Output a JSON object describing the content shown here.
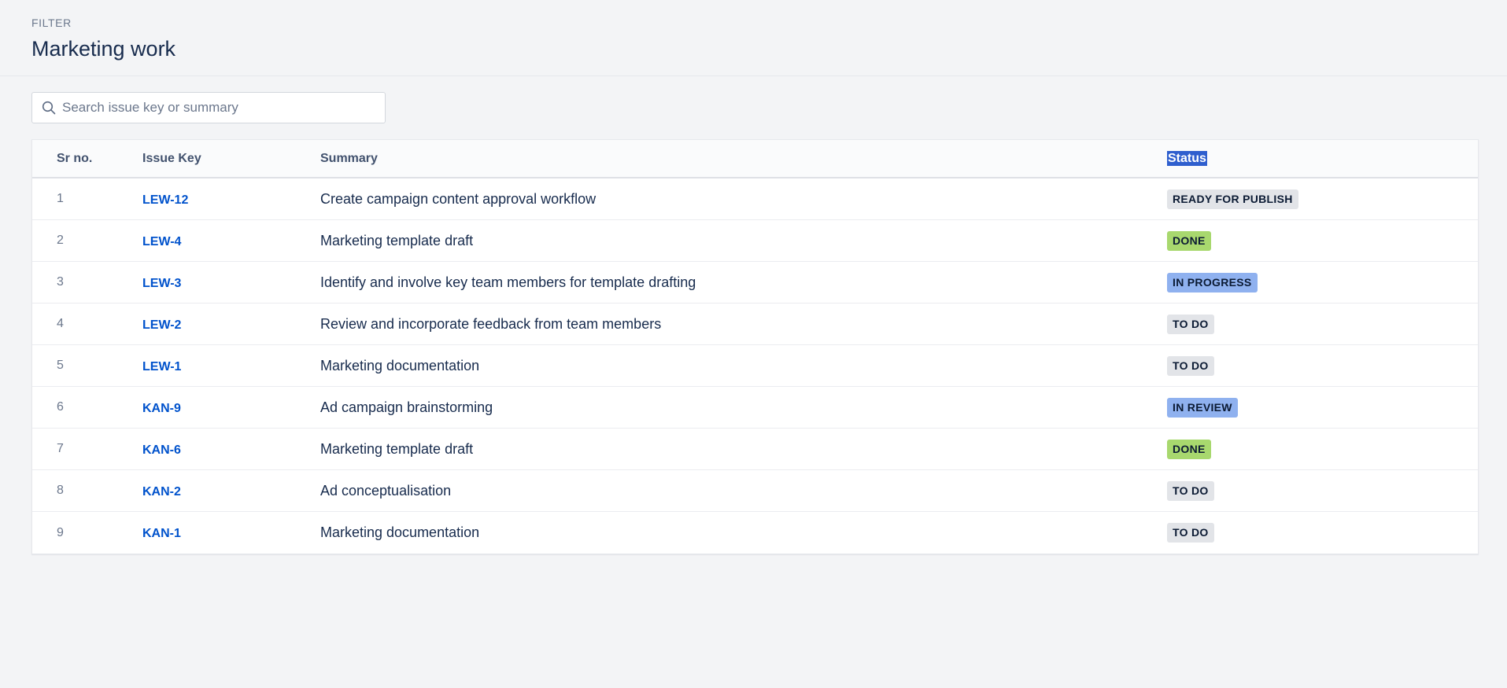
{
  "header": {
    "eyebrow": "FILTER",
    "title": "Marketing work"
  },
  "search": {
    "placeholder": "Search issue key or summary",
    "value": ""
  },
  "table": {
    "columns": {
      "sr": "Sr no.",
      "key": "Issue Key",
      "summary": "Summary",
      "status": "Status"
    },
    "rows": [
      {
        "sr": "1",
        "key": "LEW-12",
        "summary": "Create campaign content approval workflow",
        "status": "READY FOR PUBLISH",
        "status_color": "grey"
      },
      {
        "sr": "2",
        "key": "LEW-4",
        "summary": "Marketing template draft",
        "status": "DONE",
        "status_color": "green"
      },
      {
        "sr": "3",
        "key": "LEW-3",
        "summary": "Identify and involve key team members for template drafting",
        "status": "IN PROGRESS",
        "status_color": "blue"
      },
      {
        "sr": "4",
        "key": "LEW-2",
        "summary": "Review and incorporate feedback from team members",
        "status": "TO DO",
        "status_color": "grey"
      },
      {
        "sr": "5",
        "key": "LEW-1",
        "summary": "Marketing documentation",
        "status": "TO DO",
        "status_color": "grey"
      },
      {
        "sr": "6",
        "key": "KAN-9",
        "summary": "Ad campaign brainstorming",
        "status": "IN REVIEW",
        "status_color": "blue"
      },
      {
        "sr": "7",
        "key": "KAN-6",
        "summary": "Marketing template draft",
        "status": "DONE",
        "status_color": "green"
      },
      {
        "sr": "8",
        "key": "KAN-2",
        "summary": "Ad conceptualisation",
        "status": "TO DO",
        "status_color": "grey"
      },
      {
        "sr": "9",
        "key": "KAN-1",
        "summary": "Marketing documentation",
        "status": "TO DO",
        "status_color": "grey"
      }
    ]
  },
  "colors": {
    "background": "#f3f4f6",
    "link": "#0052cc",
    "status_grey": "#e2e4e8",
    "status_green": "#a8d86e",
    "status_blue": "#8fb1ef",
    "selection": "#2f5fce"
  },
  "icons": {
    "search": "search-icon"
  }
}
